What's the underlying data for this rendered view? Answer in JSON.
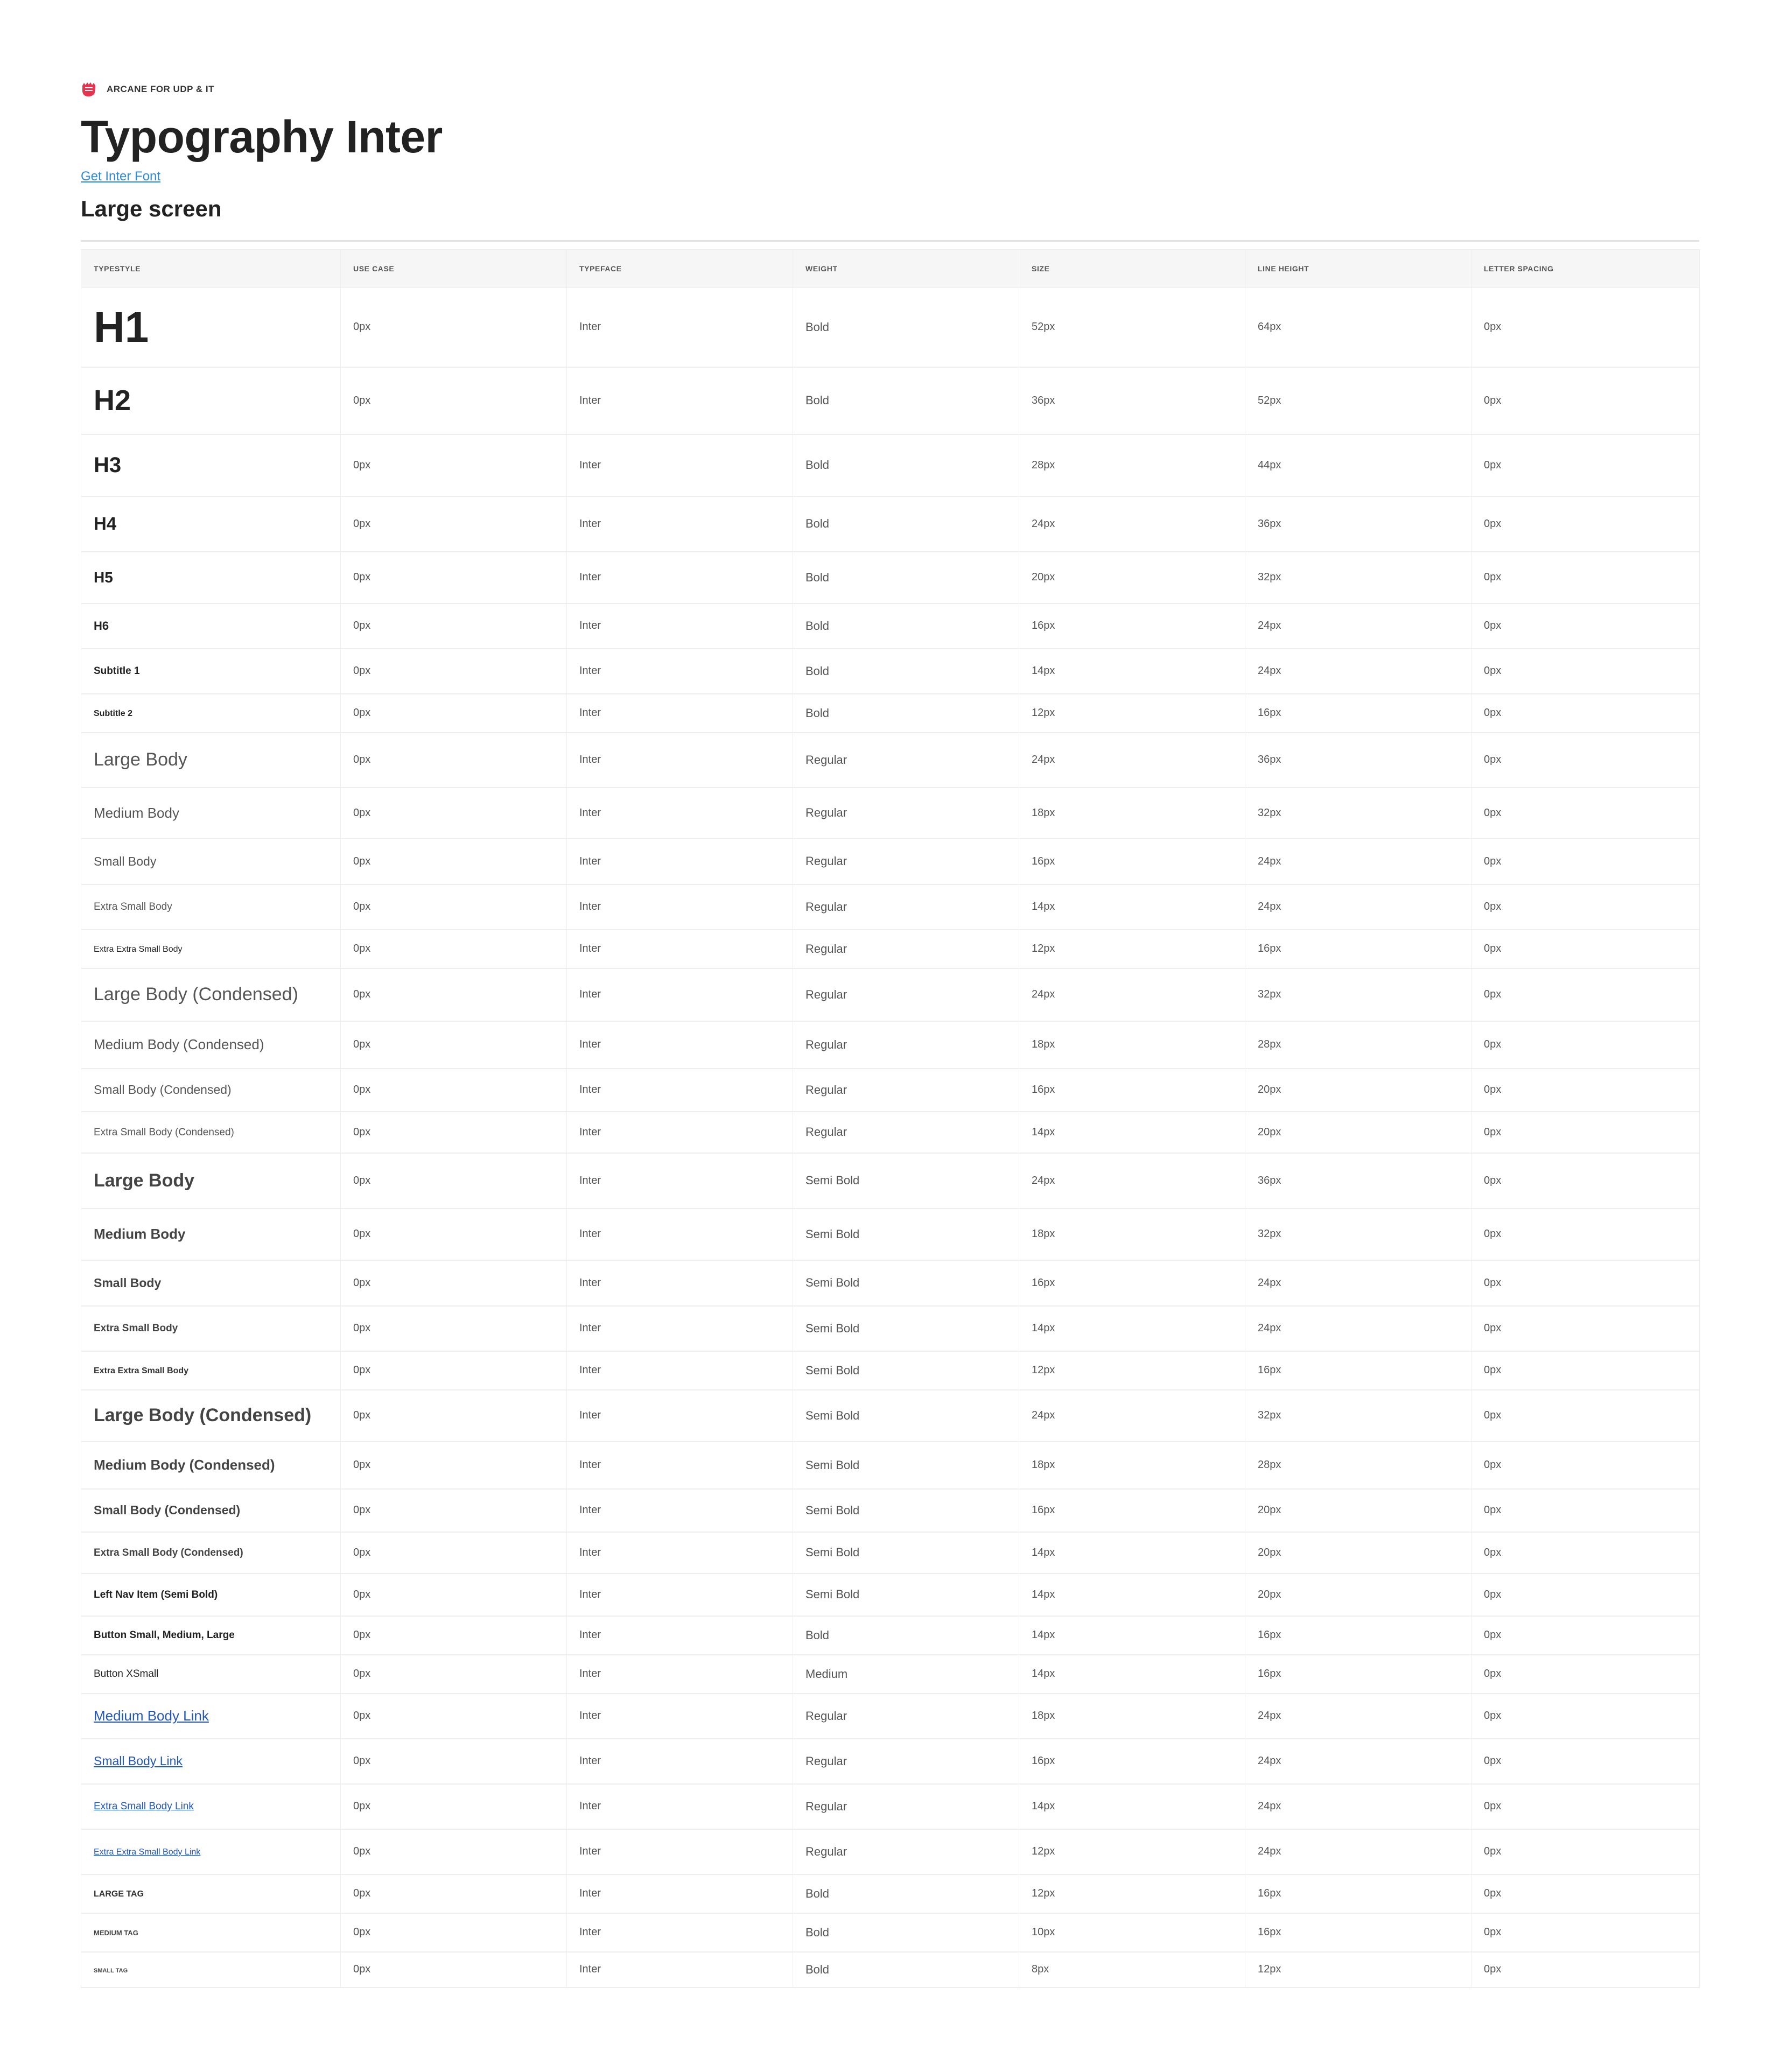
{
  "brand": {
    "text": "ARCANE FOR  UDP & IT",
    "logo_icon": "hand-logo-icon",
    "logo_color": "#e8334f"
  },
  "title": "Typography Inter",
  "font_link": "Get Inter Font",
  "section_title": "Large screen",
  "columns": [
    "TYPESTYLE",
    "USE CASE",
    "TYPEFACE",
    "WEIGHT",
    "SIZE",
    "LINE HEIGHT",
    "LETTER SPACING"
  ],
  "rows": [
    {
      "style": "H1",
      "use_case": "0px",
      "typeface": "Inter",
      "weight": "Bold",
      "size": "52px",
      "line_height": "64px",
      "letter_spacing": "0px"
    },
    {
      "style": "H2",
      "use_case": "0px",
      "typeface": "Inter",
      "weight": "Bold",
      "size": "36px",
      "line_height": "52px",
      "letter_spacing": "0px"
    },
    {
      "style": "H3",
      "use_case": "0px",
      "typeface": "Inter",
      "weight": "Bold",
      "size": "28px",
      "line_height": "44px",
      "letter_spacing": "0px"
    },
    {
      "style": "H4",
      "use_case": "0px",
      "typeface": "Inter",
      "weight": "Bold",
      "size": "24px",
      "line_height": "36px",
      "letter_spacing": "0px"
    },
    {
      "style": "H5",
      "use_case": "0px",
      "typeface": "Inter",
      "weight": "Bold",
      "size": "20px",
      "line_height": "32px",
      "letter_spacing": "0px"
    },
    {
      "style": "H6",
      "use_case": "0px",
      "typeface": "Inter",
      "weight": "Bold",
      "size": "16px",
      "line_height": "24px",
      "letter_spacing": "0px"
    },
    {
      "style": "Subtitle 1",
      "use_case": "0px",
      "typeface": "Inter",
      "weight": "Bold",
      "size": "14px",
      "line_height": "24px",
      "letter_spacing": "0px"
    },
    {
      "style": "Subtitle 2",
      "use_case": "0px",
      "typeface": "Inter",
      "weight": "Bold",
      "size": "12px",
      "line_height": "16px",
      "letter_spacing": "0px"
    },
    {
      "style": "Large Body",
      "use_case": "0px",
      "typeface": "Inter",
      "weight": "Regular",
      "size": "24px",
      "line_height": "36px",
      "letter_spacing": "0px"
    },
    {
      "style": "Medium Body",
      "use_case": "0px",
      "typeface": "Inter",
      "weight": "Regular",
      "size": "18px",
      "line_height": "32px",
      "letter_spacing": "0px"
    },
    {
      "style": "Small Body",
      "use_case": "0px",
      "typeface": "Inter",
      "weight": "Regular",
      "size": "16px",
      "line_height": "24px",
      "letter_spacing": "0px"
    },
    {
      "style": "Extra Small Body",
      "use_case": "0px",
      "typeface": "Inter",
      "weight": "Regular",
      "size": "14px",
      "line_height": "24px",
      "letter_spacing": "0px"
    },
    {
      "style": "Extra Extra Small Body",
      "use_case": "0px",
      "typeface": "Inter",
      "weight": "Regular",
      "size": "12px",
      "line_height": "16px",
      "letter_spacing": "0px"
    },
    {
      "style": "Large Body (Condensed)",
      "use_case": "0px",
      "typeface": "Inter",
      "weight": "Regular",
      "size": "24px",
      "line_height": "32px",
      "letter_spacing": "0px"
    },
    {
      "style": "Medium Body (Condensed)",
      "use_case": "0px",
      "typeface": "Inter",
      "weight": "Regular",
      "size": "18px",
      "line_height": "28px",
      "letter_spacing": "0px"
    },
    {
      "style": "Small Body (Condensed)",
      "use_case": "0px",
      "typeface": "Inter",
      "weight": "Regular",
      "size": "16px",
      "line_height": "20px",
      "letter_spacing": "0px"
    },
    {
      "style": "Extra Small Body (Condensed)",
      "use_case": "0px",
      "typeface": "Inter",
      "weight": "Regular",
      "size": "14px",
      "line_height": "20px",
      "letter_spacing": "0px"
    },
    {
      "style": "Large Body",
      "use_case": "0px",
      "typeface": "Inter",
      "weight": "Semi Bold",
      "size": "24px",
      "line_height": "36px",
      "letter_spacing": "0px"
    },
    {
      "style": "Medium Body",
      "use_case": "0px",
      "typeface": "Inter",
      "weight": "Semi Bold",
      "size": "18px",
      "line_height": "32px",
      "letter_spacing": "0px"
    },
    {
      "style": "Small Body",
      "use_case": "0px",
      "typeface": "Inter",
      "weight": "Semi Bold",
      "size": "16px",
      "line_height": "24px",
      "letter_spacing": "0px"
    },
    {
      "style": "Extra Small Body",
      "use_case": "0px",
      "typeface": "Inter",
      "weight": "Semi Bold",
      "size": "14px",
      "line_height": "24px",
      "letter_spacing": "0px"
    },
    {
      "style": "Extra Extra Small Body",
      "use_case": "0px",
      "typeface": "Inter",
      "weight": "Semi Bold",
      "size": "12px",
      "line_height": "16px",
      "letter_spacing": "0px"
    },
    {
      "style": "Large Body (Condensed)",
      "use_case": "0px",
      "typeface": "Inter",
      "weight": "Semi Bold",
      "size": "24px",
      "line_height": "32px",
      "letter_spacing": "0px"
    },
    {
      "style": "Medium Body (Condensed)",
      "use_case": "0px",
      "typeface": "Inter",
      "weight": "Semi Bold",
      "size": "18px",
      "line_height": "28px",
      "letter_spacing": "0px"
    },
    {
      "style": "Small Body (Condensed)",
      "use_case": "0px",
      "typeface": "Inter",
      "weight": "Semi Bold",
      "size": "16px",
      "line_height": "20px",
      "letter_spacing": "0px"
    },
    {
      "style": "Extra Small Body (Condensed)",
      "use_case": "0px",
      "typeface": "Inter",
      "weight": "Semi Bold",
      "size": "14px",
      "line_height": "20px",
      "letter_spacing": "0px"
    },
    {
      "style": "Left Nav Item (Semi Bold)",
      "use_case": "0px",
      "typeface": "Inter",
      "weight": "Semi Bold",
      "size": "14px",
      "line_height": "20px",
      "letter_spacing": "0px"
    },
    {
      "style": "Button Small, Medium, Large",
      "use_case": "0px",
      "typeface": "Inter",
      "weight": "Bold",
      "size": "14px",
      "line_height": "16px",
      "letter_spacing": "0px"
    },
    {
      "style": "Button XSmall",
      "use_case": "0px",
      "typeface": "Inter",
      "weight": "Medium",
      "size": "14px",
      "line_height": "16px",
      "letter_spacing": "0px"
    },
    {
      "style": "Medium Body Link",
      "use_case": "0px",
      "typeface": "Inter",
      "weight": "Regular",
      "size": "18px",
      "line_height": "24px",
      "letter_spacing": "0px"
    },
    {
      "style": "Small Body Link",
      "use_case": "0px",
      "typeface": "Inter",
      "weight": "Regular",
      "size": "16px",
      "line_height": "24px",
      "letter_spacing": "0px"
    },
    {
      "style": "Extra Small Body Link",
      "use_case": "0px",
      "typeface": "Inter",
      "weight": "Regular",
      "size": "14px",
      "line_height": "24px",
      "letter_spacing": "0px"
    },
    {
      "style": "Extra Extra Small Body Link",
      "use_case": "0px",
      "typeface": "Inter",
      "weight": "Regular",
      "size": "12px",
      "line_height": "24px",
      "letter_spacing": "0px"
    },
    {
      "style": "LARGE TAG",
      "use_case": "0px",
      "typeface": "Inter",
      "weight": "Bold",
      "size": "12px",
      "line_height": "16px",
      "letter_spacing": "0px"
    },
    {
      "style": "MEDIUM TAG",
      "use_case": "0px",
      "typeface": "Inter",
      "weight": "Bold",
      "size": "10px",
      "line_height": "16px",
      "letter_spacing": "0px"
    },
    {
      "style": "SMALL TAG",
      "use_case": "0px",
      "typeface": "Inter",
      "weight": "Bold",
      "size": "8px",
      "line_height": "12px",
      "letter_spacing": "0px"
    }
  ]
}
